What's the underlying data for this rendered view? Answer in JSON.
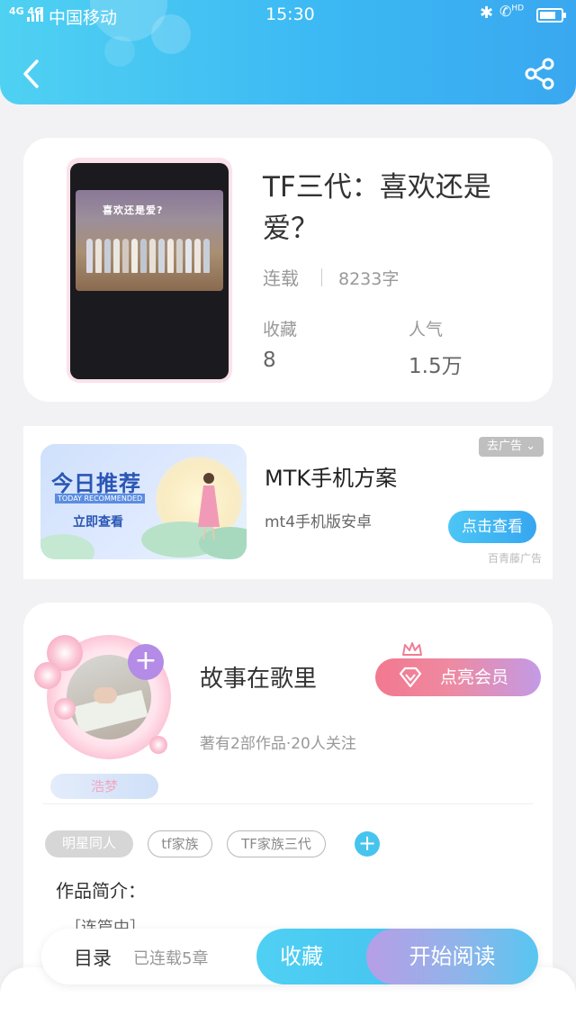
{
  "status_bar": {
    "network": "4G 4G",
    "carrier": "中国移动",
    "time": "15:30",
    "bluetooth_icon": "bluetooth-icon",
    "call_icon": "wifi-calling-icon",
    "call_label": "HD"
  },
  "header": {
    "back_icon": "chevron-left-icon",
    "share_icon": "share-icon",
    "accent": "#3bb7f3"
  },
  "book": {
    "cover_caption": "喜欢还是爱?",
    "title": "TF三代：喜欢还是爱？",
    "status": "连载",
    "word_count": "8233字",
    "stats": [
      {
        "label": "收藏",
        "value": "8"
      },
      {
        "label": "人气",
        "value": "1.5万"
      }
    ]
  },
  "ad": {
    "banner_title": "今日推荐",
    "banner_subtitle": "TODAY RECOMMENDED",
    "banner_cta": "立即查看",
    "close_label": "去广告",
    "title": "MTK手机方案",
    "description": "mt4手机版安卓",
    "button": "点击查看",
    "source": "百青藤广告"
  },
  "author": {
    "name": "故事在歌里",
    "badge": "浩梦",
    "vip_button": "点亮会员",
    "info": "著有2部作品·20人关注",
    "tags": [
      "明星同人",
      "tf家族",
      "TF家族三代"
    ],
    "intro_label": "作品简介：",
    "intro_text": "［连篇中］"
  },
  "bottom_bar": {
    "toc": "目录",
    "toc_info": "已连载5章",
    "collect": "收藏",
    "read": "开始阅读"
  }
}
